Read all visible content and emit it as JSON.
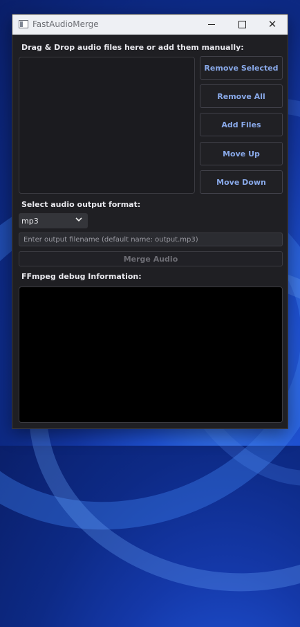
{
  "window": {
    "title": "FastAudioMerge"
  },
  "labels": {
    "drag_drop": "Drag & Drop audio files here or add them manually:",
    "output_format": "Select audio output format:",
    "debug": "FFmpeg debug Information:"
  },
  "buttons": {
    "remove_selected": "Remove Selected",
    "remove_all": "Remove All",
    "add_files": "Add Files",
    "move_up": "Move Up",
    "move_down": "Move Down",
    "merge_audio": "Merge Audio"
  },
  "format_select": {
    "value": "mp3"
  },
  "output_filename": {
    "value": "",
    "placeholder": "Enter output filename (default name: output.mp3)"
  },
  "colors": {
    "accent": "#89a9e9",
    "window_bg": "#1f1f23",
    "debug_bg": "#000000"
  },
  "icons": [
    "app-icon",
    "minimize-icon",
    "maximize-icon",
    "close-icon",
    "chevron-down-icon"
  ]
}
